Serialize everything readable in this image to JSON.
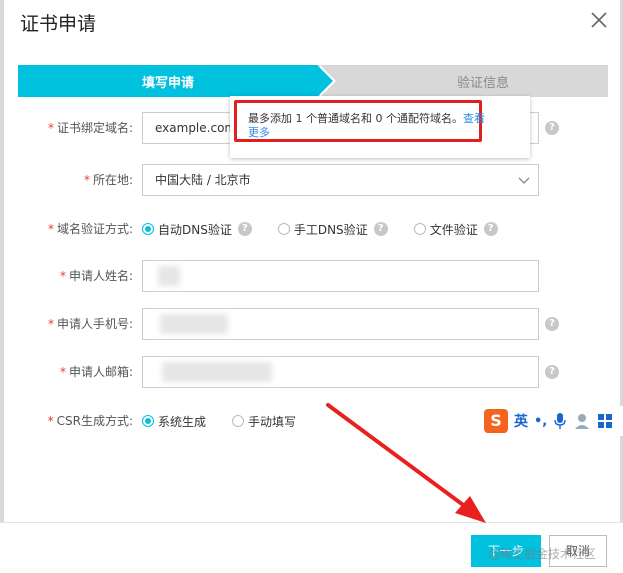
{
  "dialog": {
    "title": "证书申请"
  },
  "steps": [
    {
      "label": "填写申请",
      "active": true
    },
    {
      "label": "验证信息",
      "active": false
    }
  ],
  "form": {
    "domain": {
      "label": "证书绑定域名:",
      "value": "example.com"
    },
    "location": {
      "label": "所在地:",
      "value": "中国大陆 / 北京市"
    },
    "verify_method": {
      "label": "域名验证方式:",
      "options": [
        "自动DNS验证",
        "手工DNS验证",
        "文件验证"
      ],
      "selected": "自动DNS验证"
    },
    "applicant_name": {
      "label": "申请人姓名:"
    },
    "applicant_phone": {
      "label": "申请人手机号:"
    },
    "applicant_email": {
      "label": "申请人邮箱:"
    },
    "csr_method": {
      "label": "CSR生成方式:",
      "options": [
        "系统生成",
        "手动填写"
      ],
      "selected": "系统生成"
    }
  },
  "tooltip": {
    "text": "最多添加 1 个普通域名和 0 个通配符域名。",
    "link_part1": "查看",
    "link_part2": "更多"
  },
  "ime": {
    "logo": "S",
    "mode": "英"
  },
  "footer": {
    "next_label": "下一步",
    "cancel_label": "取消",
    "watermark": "@稀土掘金技术社区"
  },
  "colors": {
    "accent": "#00c1de",
    "required": "#e4393c",
    "highlight": "#e02020"
  }
}
